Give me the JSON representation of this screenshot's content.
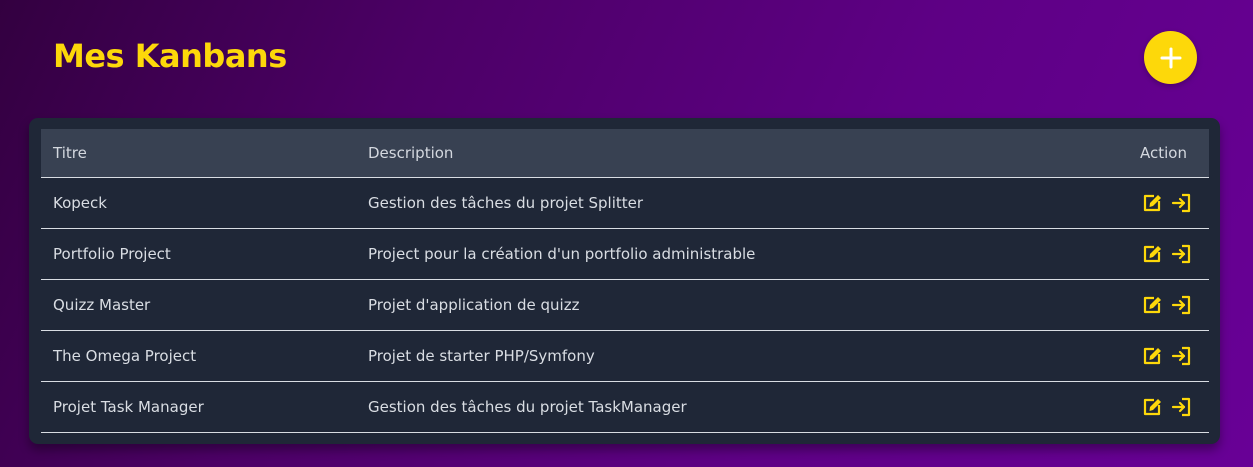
{
  "page": {
    "title": "Mes Kanbans"
  },
  "add_button": {
    "icon": "plus-icon"
  },
  "table": {
    "headers": {
      "title": "Titre",
      "description": "Description",
      "action": "Action"
    },
    "rows": [
      {
        "title": "Kopeck",
        "description": "Gestion des tâches du projet Splitter"
      },
      {
        "title": "Portfolio Project",
        "description": "Project pour la création d'un portfolio administrable"
      },
      {
        "title": "Quizz Master",
        "description": "Projet d'application de quizz"
      },
      {
        "title": "The Omega Project",
        "description": "Projet de starter PHP/Symfony"
      },
      {
        "title": "Projet Task Manager",
        "description": "Gestion des tâches du projet TaskManager"
      }
    ],
    "row_actions": [
      "edit-icon",
      "enter-icon"
    ]
  },
  "colors": {
    "accent": "#fdd80a",
    "card_background": "#1f2737",
    "header_background": "#384152",
    "text": "#d9dde3"
  }
}
